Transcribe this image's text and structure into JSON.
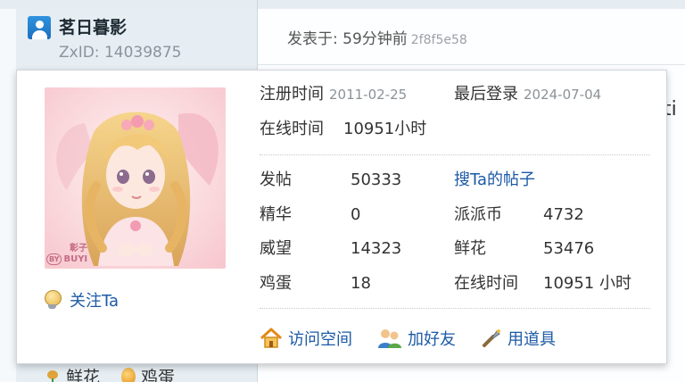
{
  "post": {
    "author_name": "茗日暮影",
    "author_id": "ZxID:  14039875",
    "posted_label": "发表于: 59分钟前",
    "post_hash": "2f8f5e58",
    "clipped_text": "ti"
  },
  "bottom_actions": {
    "flower_label": "鲜花",
    "egg_label": "鸡蛋"
  },
  "profile_card": {
    "portrait_signature": "彰子",
    "portrait_signature_by": "BY",
    "portrait_signature_name": "BUYI",
    "follow_label": "关注Ta",
    "register": {
      "label": "注册时间",
      "value": "2011-02-25"
    },
    "last_login": {
      "label": "最后登录",
      "value": "2024-07-04"
    },
    "online_top": {
      "label": "在线时间",
      "value": "10951小时"
    },
    "stats": {
      "posts": {
        "label": "发帖",
        "value": "50333"
      },
      "search_posts_link": "搜Ta的帖子",
      "digest": {
        "label": "精华",
        "value": "0"
      },
      "coins": {
        "label": "派派币",
        "value": "4732"
      },
      "prestige": {
        "label": "威望",
        "value": "14323"
      },
      "flowers": {
        "label": "鲜花",
        "value": "53476"
      },
      "eggs": {
        "label": "鸡蛋",
        "value": "18"
      },
      "online": {
        "label": "在线时间",
        "value": "10951 小时"
      }
    },
    "actions": {
      "visit_space": "访问空间",
      "add_friend": "加好友",
      "use_item": "用道具"
    }
  },
  "colors": {
    "link": "#1c5aa6",
    "muted": "#8b9298",
    "sidebar_bg": "#e6eef3"
  },
  "icons": [
    "user-avatar-icon",
    "flower-icon",
    "egg-icon",
    "bulb-icon",
    "home-icon",
    "add-friend-icon",
    "tool-icon"
  ]
}
